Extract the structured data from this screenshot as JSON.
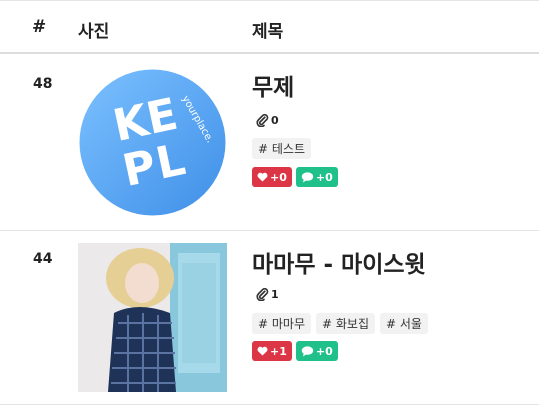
{
  "header": {
    "col_num": "#",
    "col_photo": "사진",
    "col_title": "제목"
  },
  "rows": [
    {
      "num": "48",
      "title": "무제",
      "attachments": "0",
      "tags": [
        "# 테스트"
      ],
      "likes": "+0",
      "comments": "+0",
      "thumb": {
        "letters": [
          "K",
          "E",
          "P",
          "L"
        ],
        "subtext": "yourplace."
      }
    },
    {
      "num": "44",
      "title": "마마무 - 마이스윗",
      "attachments": "1",
      "tags": [
        "# 마마무",
        "# 화보집",
        "# 서울"
      ],
      "likes": "+1",
      "comments": "+0"
    }
  ],
  "colors": {
    "like": "#dc3545",
    "comment": "#20c08a",
    "logo_blue": "#5aa8f5"
  }
}
